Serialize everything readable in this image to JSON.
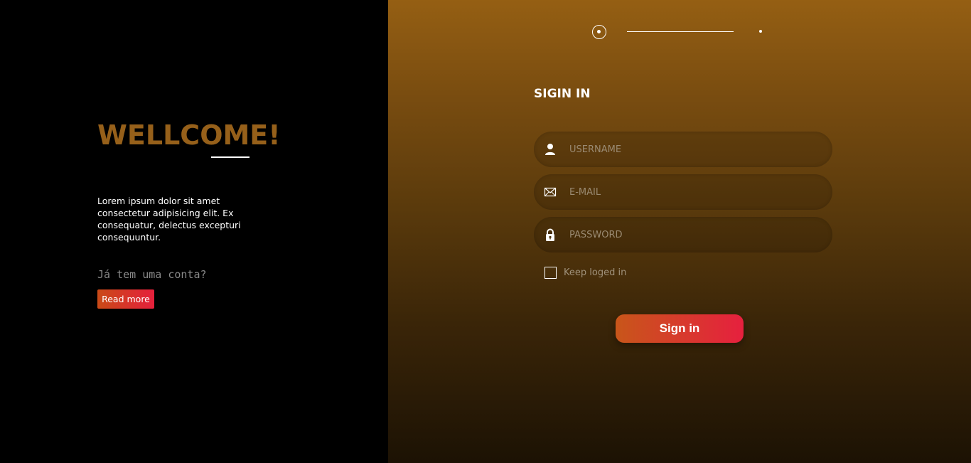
{
  "left": {
    "title": "WELLCOME!",
    "description": "Lorem ipsum dolor sit amet consectetur adipisicing elit. Ex consequatur, delectus excepturi consequuntur.",
    "account_prompt": "Já tem uma conta?",
    "read_more_label": "Read more"
  },
  "right": {
    "title": "SIGIN IN",
    "username": {
      "placeholder": "USERNAME",
      "value": "",
      "icon": "user-icon"
    },
    "email": {
      "placeholder": "E-MAIL",
      "value": "",
      "icon": "mail-icon"
    },
    "password": {
      "placeholder": "PASSWORD",
      "value": "",
      "icon": "lock-icon"
    },
    "keep_logged_label": "Keep loged in",
    "keep_logged_checked": false,
    "signin_label": "Sign in"
  },
  "colors": {
    "accent": "#96601a",
    "button_gradient_start": "#c94a17",
    "button_gradient_end": "#e5203c",
    "panel_top": "#955f13",
    "panel_bottom": "#1c1204"
  }
}
